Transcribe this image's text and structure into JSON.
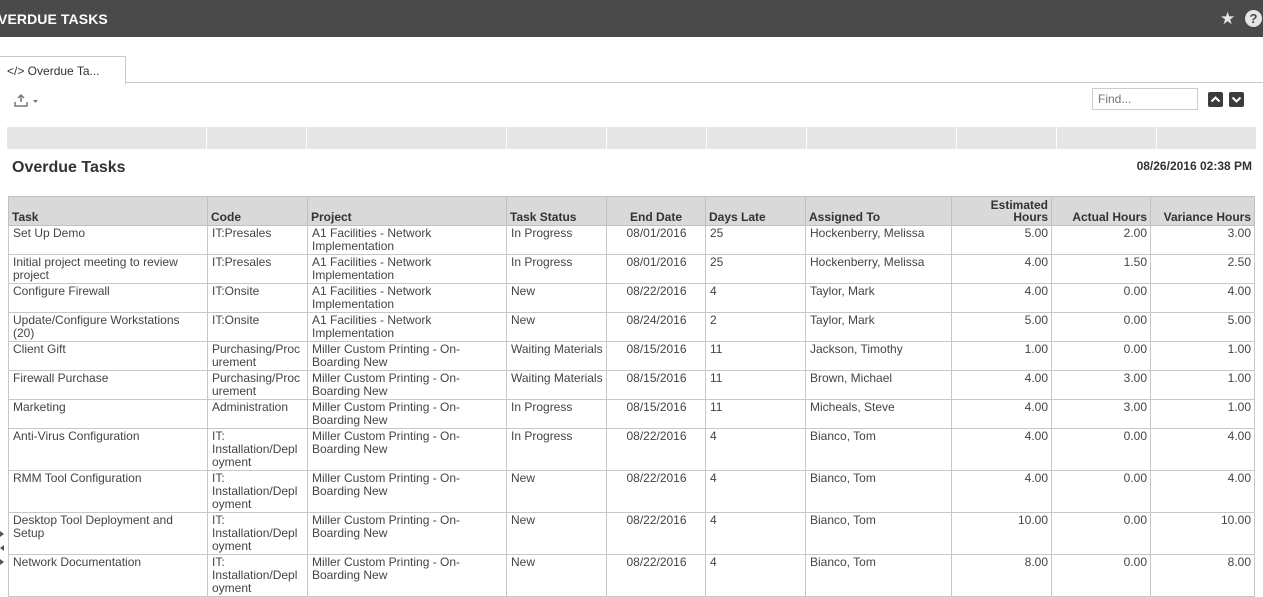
{
  "window": {
    "title": "VERDUE TASKS",
    "star_icon": "★",
    "help_icon": "?"
  },
  "tab": {
    "label": "</> Overdue Ta..."
  },
  "find": {
    "placeholder": "Find..."
  },
  "report": {
    "title": "Overdue Tasks",
    "timestamp": "08/26/2016 02:38 PM"
  },
  "columns": [
    "Task",
    "Code",
    "Project",
    "Task Status",
    "End Date",
    "Days Late",
    "Assigned To",
    "Estimated Hours",
    "Actual Hours",
    "Variance Hours"
  ],
  "rows": [
    [
      "Set Up Demo",
      "IT:Presales",
      "A1 Facilities - Network Implementation",
      "In Progress",
      "08/01/2016",
      "25",
      "Hockenberry, Melissa",
      "5.00",
      "2.00",
      "3.00"
    ],
    [
      "Initial project meeting to review project",
      "IT:Presales",
      "A1 Facilities - Network Implementation",
      "In Progress",
      "08/01/2016",
      "25",
      "Hockenberry, Melissa",
      "4.00",
      "1.50",
      "2.50"
    ],
    [
      "Configure Firewall",
      "IT:Onsite",
      "A1 Facilities - Network Implementation",
      "New",
      "08/22/2016",
      "4",
      "Taylor, Mark",
      "4.00",
      "0.00",
      "4.00"
    ],
    [
      "Update/Configure Workstations (20)",
      "IT:Onsite",
      "A1 Facilities - Network Implementation",
      "New",
      "08/24/2016",
      "2",
      "Taylor, Mark",
      "5.00",
      "0.00",
      "5.00"
    ],
    [
      "Client Gift",
      "Purchasing/Proc urement",
      "Miller Custom Printing - On-Boarding New",
      "Waiting Materials",
      "08/15/2016",
      "11",
      "Jackson, Timothy",
      "1.00",
      "0.00",
      "1.00"
    ],
    [
      "Firewall Purchase",
      "Purchasing/Proc urement",
      "Miller Custom Printing - On-Boarding New",
      "Waiting Materials",
      "08/15/2016",
      "11",
      "Brown, Michael",
      "4.00",
      "3.00",
      "1.00"
    ],
    [
      "Marketing",
      "Administration",
      "Miller Custom Printing - On-Boarding New",
      "In Progress",
      "08/15/2016",
      "11",
      "Micheals, Steve",
      "4.00",
      "3.00",
      "1.00"
    ],
    [
      "Anti-Virus Configuration",
      "IT: Installation/Depl oyment",
      "Miller Custom Printing - On-Boarding New",
      "In Progress",
      "08/22/2016",
      "4",
      "Bianco, Tom",
      "4.00",
      "0.00",
      "4.00"
    ],
    [
      "RMM Tool Configuration",
      "IT: Installation/Depl oyment",
      "Miller Custom Printing - On-Boarding New",
      "New",
      "08/22/2016",
      "4",
      "Bianco, Tom",
      "4.00",
      "0.00",
      "4.00"
    ],
    [
      "Desktop Tool Deployment and Setup",
      "IT: Installation/Depl oyment",
      "Miller Custom Printing - On-Boarding New",
      "New",
      "08/22/2016",
      "4",
      "Bianco, Tom",
      "10.00",
      "0.00",
      "10.00"
    ],
    [
      "Network Documentation",
      "IT: Installation/Depl oyment",
      "Miller Custom Printing - On-Boarding New",
      "New",
      "08/22/2016",
      "4",
      "Bianco, Tom",
      "8.00",
      "0.00",
      "8.00"
    ]
  ],
  "colors": {
    "titlebar": "#4a4a4a",
    "header_bg": "#d9d9d9",
    "band": "#e6e6e6"
  }
}
